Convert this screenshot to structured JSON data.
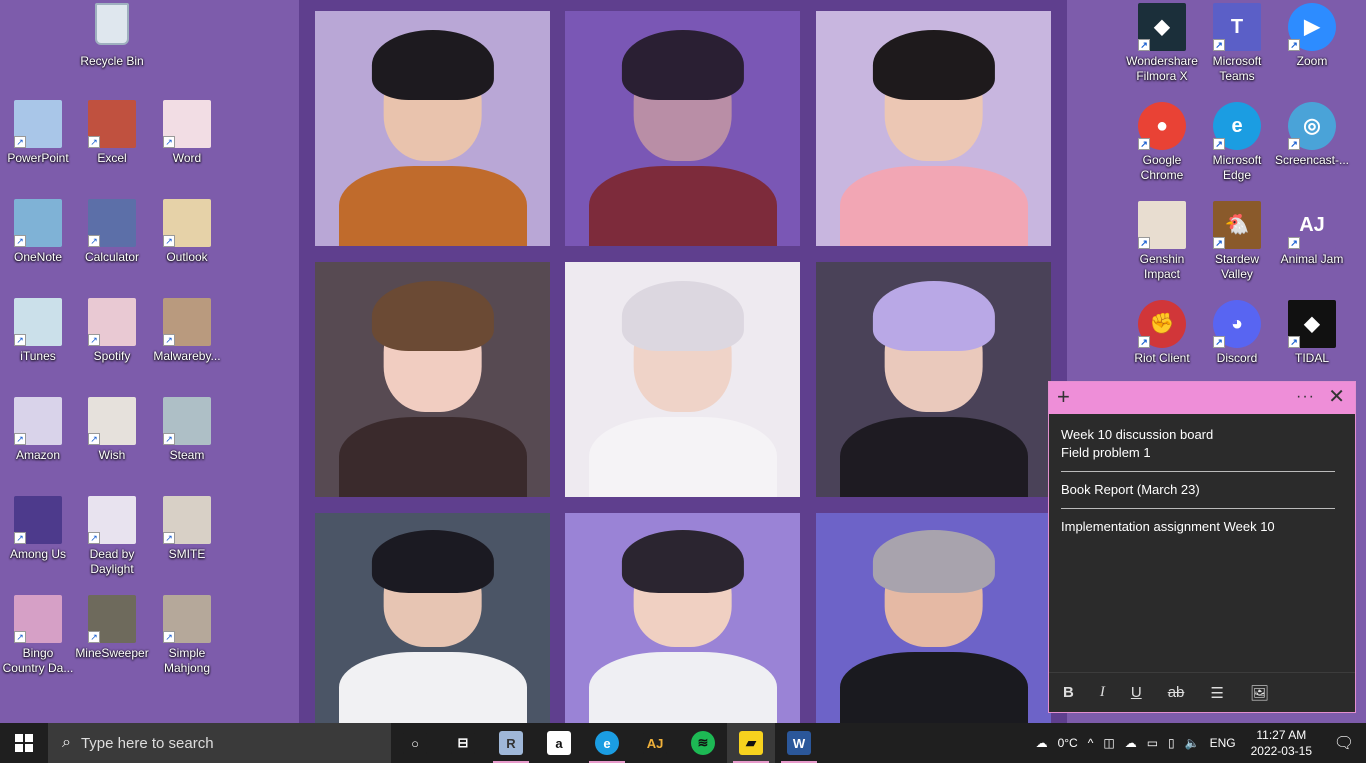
{
  "desktop": {
    "left_icons": [
      {
        "label": "Recycle Bin",
        "icon": "recycle-bin-icon",
        "color": "#cfd8e0"
      },
      {
        "label": "PowerPoint",
        "icon": "powerpoint-shortcut-icon",
        "color": "#a9c6e8"
      },
      {
        "label": "Excel",
        "icon": "excel-shortcut-icon",
        "color": "#c0513f"
      },
      {
        "label": "Word",
        "icon": "word-shortcut-icon",
        "color": "#f2dde4"
      },
      {
        "label": "OneNote",
        "icon": "onenote-shortcut-icon",
        "color": "#7fb2d6"
      },
      {
        "label": "Calculator",
        "icon": "calculator-shortcut-icon",
        "color": "#5c6fa8"
      },
      {
        "label": "Outlook",
        "icon": "outlook-shortcut-icon",
        "color": "#e6d2a8"
      },
      {
        "label": "iTunes",
        "icon": "itunes-shortcut-icon",
        "color": "#cbe0ea"
      },
      {
        "label": "Spotify",
        "icon": "spotify-shortcut-icon",
        "color": "#e9c9d3"
      },
      {
        "label": "Malwareby...",
        "icon": "malwarebytes-shortcut-icon",
        "color": "#b99a7e"
      },
      {
        "label": "Amazon",
        "icon": "amazon-shortcut-icon",
        "color": "#d9d3ea"
      },
      {
        "label": "Wish",
        "icon": "wish-shortcut-icon",
        "color": "#e6e1dc"
      },
      {
        "label": "Steam",
        "icon": "steam-shortcut-icon",
        "color": "#aebfc6"
      },
      {
        "label": "Among Us",
        "icon": "among-us-shortcut-icon",
        "color": "#4d3a8c"
      },
      {
        "label": "Dead by\nDaylight",
        "icon": "dead-by-daylight-shortcut-icon",
        "color": "#e8e3ef"
      },
      {
        "label": "SMITE",
        "icon": "smite-shortcut-icon",
        "color": "#d8d0c6"
      },
      {
        "label": "Bingo\nCountry Da...",
        "icon": "bingo-shortcut-icon",
        "color": "#d6a0c6"
      },
      {
        "label": "MineSweeper",
        "icon": "minesweeper-shortcut-icon",
        "color": "#6e6a5c"
      },
      {
        "label": "Simple\nMahjong",
        "icon": "mahjong-shortcut-icon",
        "color": "#b5a89a"
      }
    ],
    "right_icons": [
      {
        "label": "Wondershare\nFilmora X",
        "icon": "filmora-icon",
        "color": "#1b2f3a",
        "glyph": "◆"
      },
      {
        "label": "Microsoft\nTeams",
        "icon": "teams-icon",
        "color": "#5b5fc7",
        "glyph": "T"
      },
      {
        "label": "Zoom",
        "icon": "zoom-icon",
        "color": "#2d8cff",
        "glyph": "▶"
      },
      {
        "label": "Google\nChrome",
        "icon": "chrome-icon",
        "color": "#e94235",
        "glyph": "●"
      },
      {
        "label": "Microsoft\nEdge",
        "icon": "edge-icon",
        "color": "#1b9de2",
        "glyph": "e"
      },
      {
        "label": "Screencast-...",
        "icon": "screencast-icon",
        "color": "#4aa3d8",
        "glyph": "◎"
      },
      {
        "label": "Genshin\nImpact",
        "icon": "genshin-impact-icon",
        "color": "#e8ddd0",
        "glyph": ""
      },
      {
        "label": "Stardew\nValley",
        "icon": "stardew-valley-icon",
        "color": "#8a5a2b",
        "glyph": "🐔"
      },
      {
        "label": "Animal Jam",
        "icon": "animal-jam-icon",
        "color": "#7d5cab",
        "glyph": "AJ"
      },
      {
        "label": "Riot Client",
        "icon": "riot-client-icon",
        "color": "#d13639",
        "glyph": "✊"
      },
      {
        "label": "Discord",
        "icon": "discord-icon",
        "color": "#5865f2",
        "glyph": "◕"
      },
      {
        "label": "TIDAL",
        "icon": "tidal-icon",
        "color": "#111111",
        "glyph": "◆"
      }
    ]
  },
  "photos": [
    {
      "bg": "#b9a7d6",
      "hair": "#1d1a1f",
      "skin": "#e9c3ad",
      "shirt": "#c06b2c"
    },
    {
      "bg": "#7a57b5",
      "hair": "#2a1f33",
      "skin": "#b98ea6",
      "shirt": "#7d2b3b"
    },
    {
      "bg": "#c8b6df",
      "hair": "#1e1a1c",
      "skin": "#ecc7b4",
      "shirt": "#f2a6b4"
    },
    {
      "bg": "#574a52",
      "hair": "#6b4a34",
      "skin": "#f1cdc1",
      "shirt": "#3a2a2c"
    },
    {
      "bg": "#eeeaf0",
      "hair": "#dcd7e0",
      "skin": "#efd3c8",
      "shirt": "#f5f3f6"
    },
    {
      "bg": "#4a4258",
      "hair": "#b9a8e6",
      "skin": "#eac9bc",
      "shirt": "#1e1b22"
    },
    {
      "bg": "#4b5566",
      "hair": "#1b1a22",
      "skin": "#e7c5b3",
      "shirt": "#f1f1f3"
    },
    {
      "bg": "#9a83d6",
      "hair": "#2b2530",
      "skin": "#f0d0c2",
      "shirt": "#efeff3"
    },
    {
      "bg": "#6d63c8",
      "hair": "#a8a3ad",
      "skin": "#e5b9a4",
      "shirt": "#1a1a1f"
    }
  ],
  "sticky_note": {
    "lines_block1": [
      "Week 10 discussion board",
      "Field problem 1"
    ],
    "lines_block2": [
      "Book Report (March 23)"
    ],
    "lines_block3": [
      "Implementation assignment Week 10"
    ],
    "toolbar": {
      "bold": "B",
      "italic": "I",
      "underline": "U",
      "strikethrough": "ab",
      "list": "☰",
      "image": "🖼"
    },
    "header_add": "+",
    "header_more": "···",
    "header_close": "✕"
  },
  "taskbar": {
    "search_placeholder": "Type here to search",
    "weather": "0°C",
    "language": "ENG",
    "time": "11:27 AM",
    "date": "2022-03-15",
    "apps": [
      {
        "name": "task-view",
        "glyph": "○",
        "color": "#1f1f1f",
        "fg": "#ffffff"
      },
      {
        "name": "widgets",
        "glyph": "⊟",
        "color": "#1f1f1f",
        "fg": "#ffffff"
      },
      {
        "name": "user",
        "glyph": "R",
        "color": "#9fb7d8",
        "fg": "#333333"
      },
      {
        "name": "amazon",
        "glyph": "a",
        "color": "#ffffff",
        "fg": "#111111"
      },
      {
        "name": "edge",
        "glyph": "e",
        "color": "#1b9de2",
        "fg": "#ffffff"
      },
      {
        "name": "animal-jam",
        "glyph": "AJ",
        "color": "#1f1f1f",
        "fg": "#f0b13a"
      },
      {
        "name": "spotify",
        "glyph": "≋",
        "color": "#1db954",
        "fg": "#111111"
      },
      {
        "name": "sticky-notes",
        "glyph": "▰",
        "color": "#f7d21e",
        "fg": "#111111"
      },
      {
        "name": "word",
        "glyph": "W",
        "color": "#2b579a",
        "fg": "#ffffff"
      }
    ]
  }
}
